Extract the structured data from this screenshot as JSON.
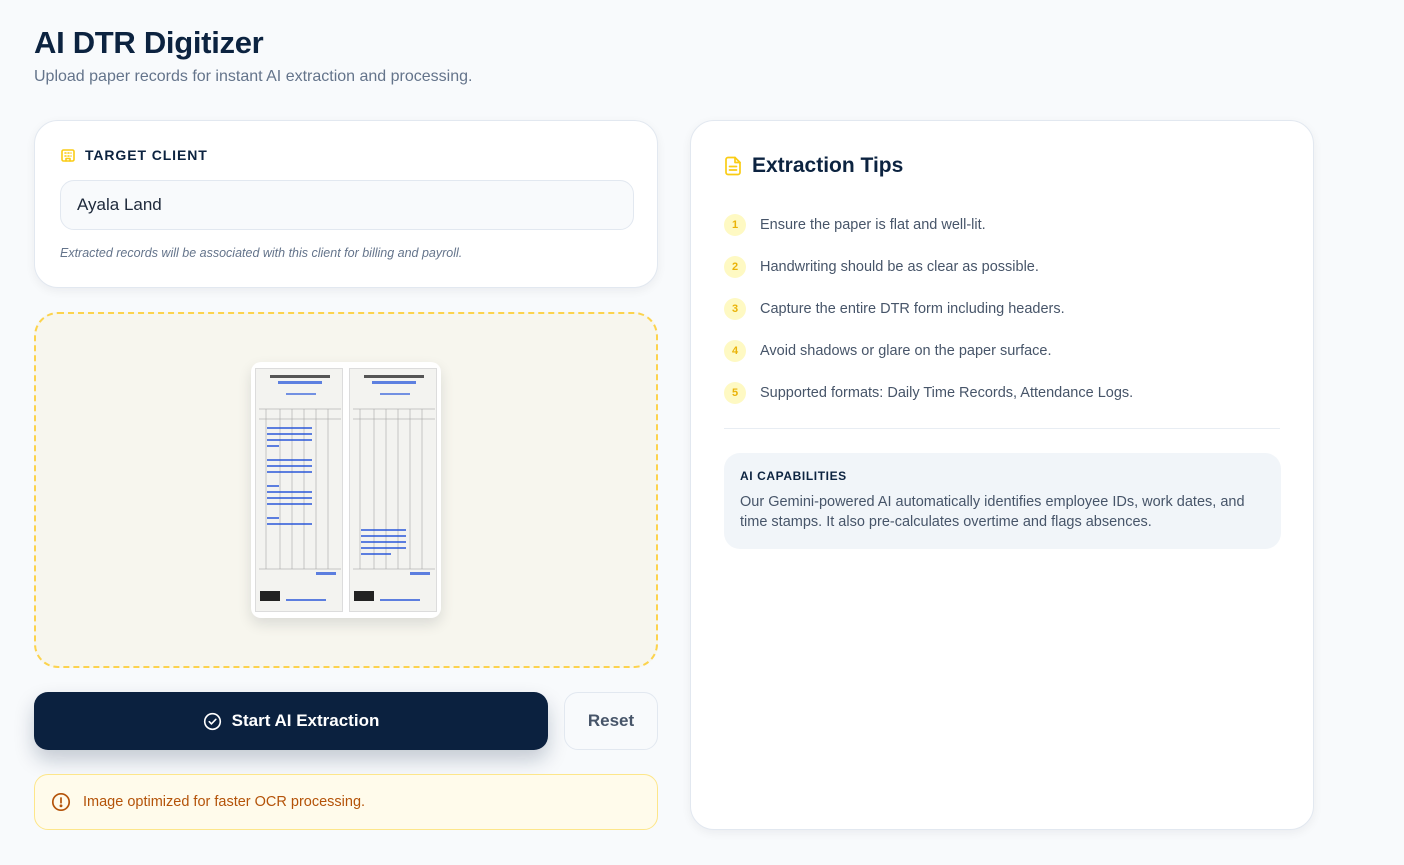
{
  "header": {
    "title": "AI DTR Digitizer",
    "subtitle": "Upload paper records for instant AI extraction and processing."
  },
  "client": {
    "label": "TARGET CLIENT",
    "value": "Ayala Land",
    "note": "Extracted records will be associated with this client for billing and payroll."
  },
  "upload": {
    "icon": "dtr-document-preview"
  },
  "actions": {
    "start_label": "Start AI Extraction",
    "reset_label": "Reset"
  },
  "notice": {
    "text": "Image optimized for faster OCR processing."
  },
  "tips": {
    "title": "Extraction Tips",
    "items": [
      {
        "num": "1",
        "text": "Ensure the paper is flat and well-lit."
      },
      {
        "num": "2",
        "text": "Handwriting should be as clear as possible."
      },
      {
        "num": "3",
        "text": "Capture the entire DTR form including headers."
      },
      {
        "num": "4",
        "text": "Avoid shadows or glare on the paper surface."
      },
      {
        "num": "5",
        "text": "Supported formats: Daily Time Records, Attendance Logs."
      }
    ],
    "capabilities": {
      "title": "AI CAPABILITIES",
      "text": "Our Gemini-powered AI automatically identifies employee IDs, work dates, and time stamps. It also pre-calculates overtime and flags absences."
    }
  },
  "colors": {
    "primary": "#0b213f",
    "accent": "#facc15",
    "warning": "#b45309"
  }
}
